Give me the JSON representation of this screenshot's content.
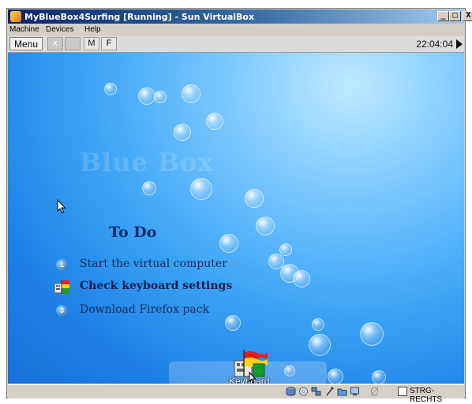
{
  "window": {
    "title": "MyBlueBox4Surfing [Running] - Sun VirtualBox",
    "controls": {
      "minimize": "_",
      "maximize": "□",
      "close": "X"
    }
  },
  "menubar": {
    "items": [
      "Machine",
      "Devices",
      "Help"
    ]
  },
  "guest_bar": {
    "menu_label": "Menu",
    "x_label": "x",
    "m_label": "M",
    "f_label": "F",
    "clock": "22:04:04"
  },
  "desktop": {
    "brand": "Blue Box",
    "todo": {
      "title": "To Do",
      "items": [
        {
          "label": "Start the virtual computer",
          "badge": "1",
          "done": true
        },
        {
          "label": "Check keyboard settings",
          "badge": "",
          "done": false,
          "icon": "keyboard-icon"
        },
        {
          "label": "Download Firefox pack",
          "badge": "3",
          "done": false
        }
      ]
    },
    "launcher": {
      "label": "Keyboard",
      "icon": "keyboard-flag-icon"
    }
  },
  "statusbar": {
    "host_key_label": "STRG-RECHTS",
    "icons": [
      "hard-disk-icon",
      "cd-icon",
      "floppy-icon",
      "usb-icon",
      "network-icon",
      "shared-folder-icon",
      "mouse-integration-icon",
      "host-key-icon"
    ]
  },
  "colors": {
    "titlebar_start": "#0a246a",
    "titlebar_end": "#a6caf0",
    "desktop_blue": "#1d7fe4",
    "todo_text": "#12285c"
  }
}
